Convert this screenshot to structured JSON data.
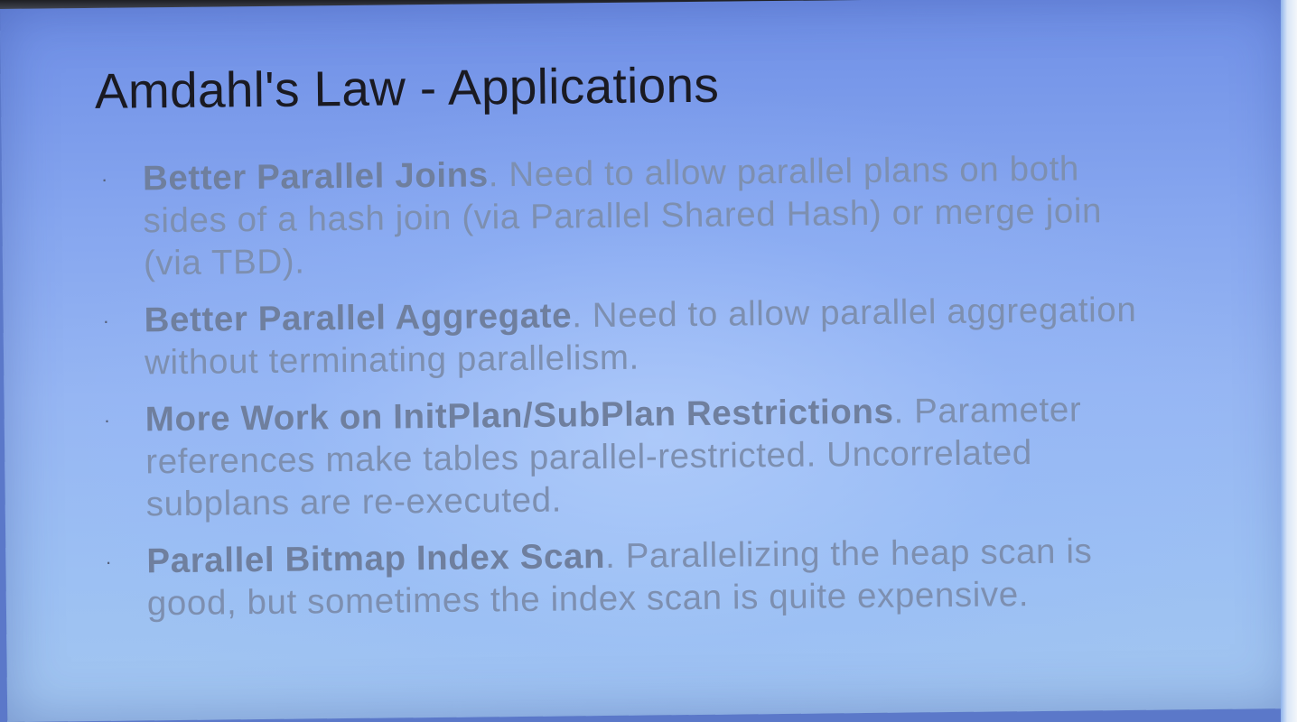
{
  "slide": {
    "title": "Amdahl's Law - Applications",
    "bullet_marker": "·",
    "items": [
      {
        "heading": "Better Parallel Joins",
        "text": ".  Need to allow parallel plans on both sides of a hash join (via Parallel Shared Hash) or merge join (via TBD)."
      },
      {
        "heading": "Better Parallel Aggregate",
        "text": ".  Need to allow parallel aggregation without terminating parallelism."
      },
      {
        "heading": "More Work on InitPlan/SubPlan Restrictions",
        "text": ". Parameter references make tables parallel-restricted. Uncorrelated subplans are re-executed."
      },
      {
        "heading": "Parallel Bitmap Index Scan",
        "text": ".  Parallelizing the heap scan is good, but sometimes the index scan is quite expensive."
      }
    ]
  }
}
